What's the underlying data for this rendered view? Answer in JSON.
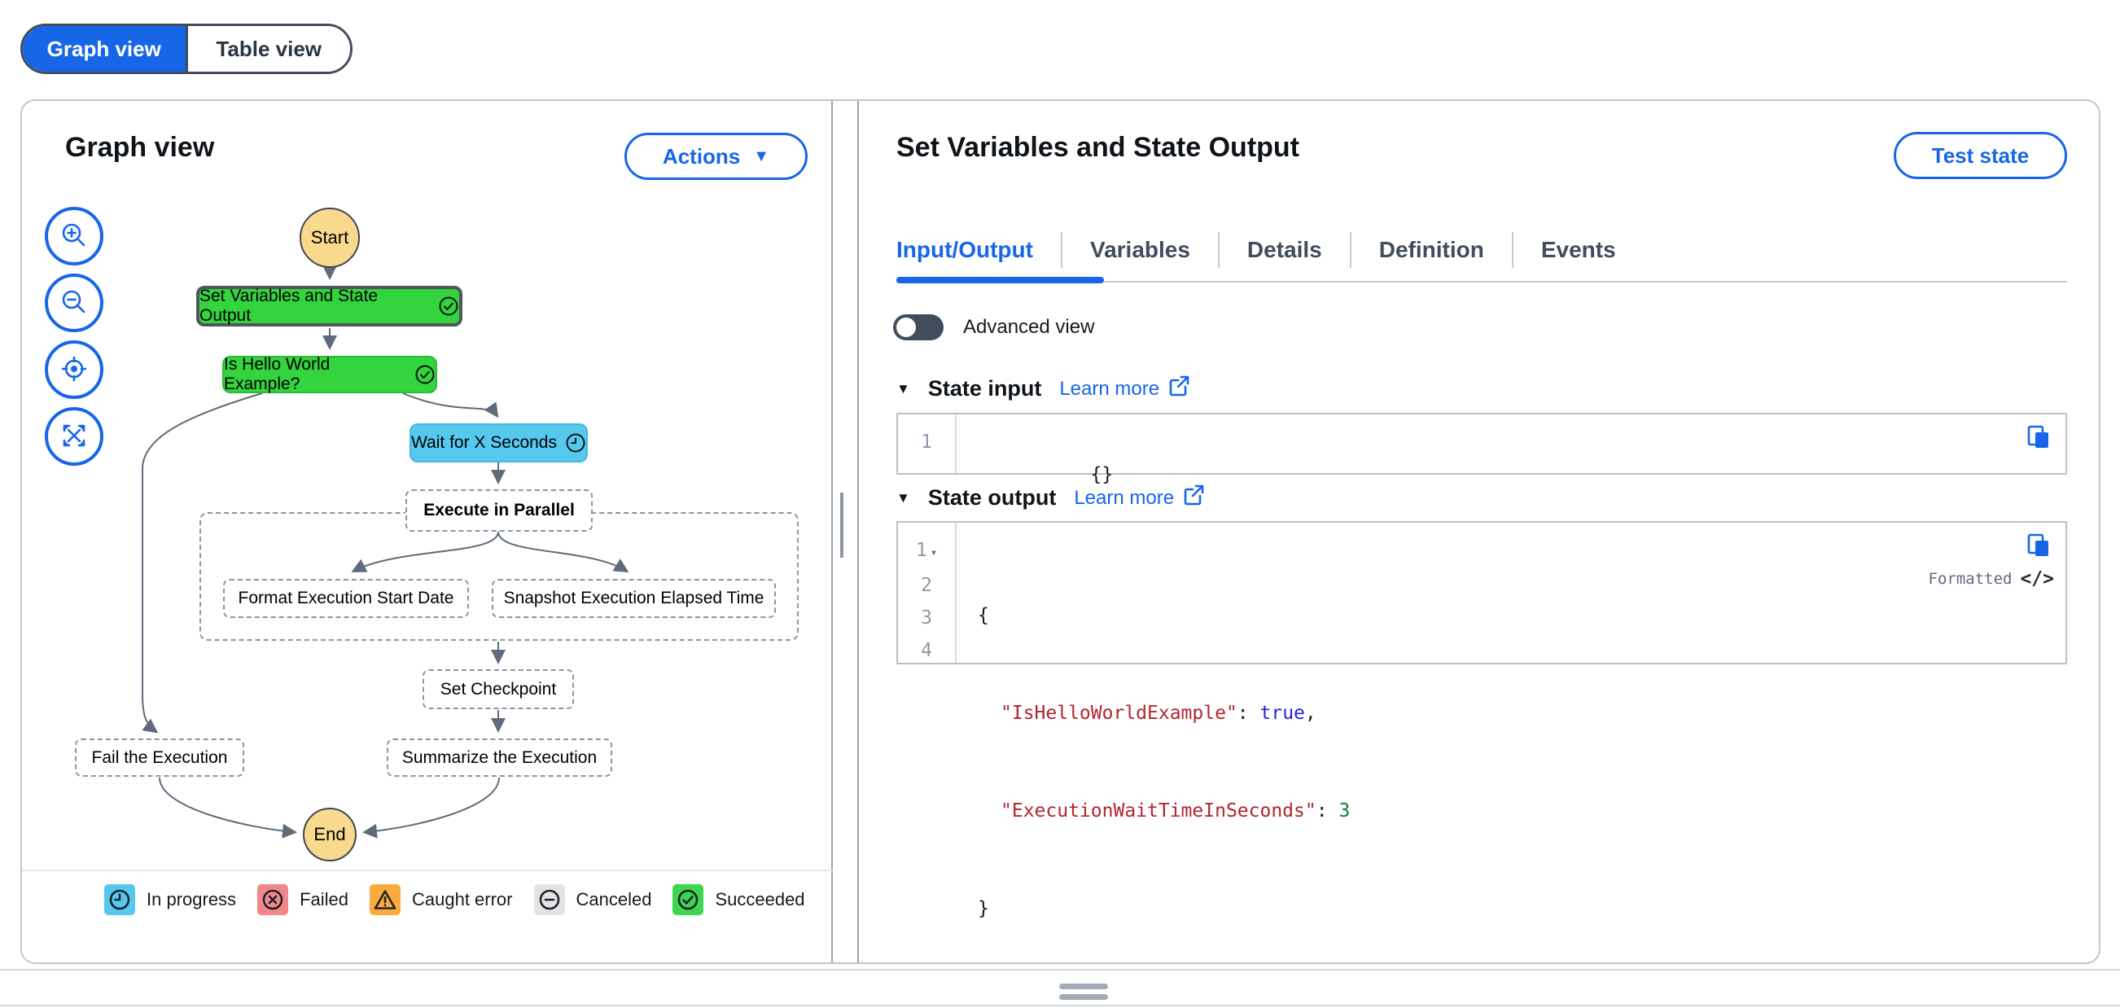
{
  "view_toggle": {
    "graph_label": "Graph view",
    "table_label": "Table view"
  },
  "graph_panel": {
    "title": "Graph view",
    "actions_label": "Actions",
    "zoom_controls": [
      "zoom-in",
      "zoom-out",
      "center-view",
      "fullscreen"
    ],
    "nodes": {
      "start": "Start",
      "set_variables": "Set Variables and State Output",
      "is_hello": "Is Hello World Example?",
      "wait": "Wait for X Seconds",
      "parallel": "Execute in Parallel",
      "format_date": "Format Execution Start Date",
      "snapshot": "Snapshot Execution Elapsed Time",
      "checkpoint": "Set Checkpoint",
      "summarize": "Summarize the Execution",
      "fail": "Fail the Execution",
      "end": "End"
    },
    "legend": [
      {
        "icon": "clock-icon",
        "label": "In progress",
        "color": "#56c8ee"
      },
      {
        "icon": "x-circle-icon",
        "label": "Failed",
        "color": "#f38688"
      },
      {
        "icon": "warning-icon",
        "label": "Caught error",
        "color": "#fbab3c"
      },
      {
        "icon": "minus-circle-icon",
        "label": "Canceled",
        "color": "#e3e3e3"
      },
      {
        "icon": "check-circle-icon",
        "label": "Succeeded",
        "color": "#3fd64f"
      }
    ]
  },
  "details_panel": {
    "title": "Set Variables and State Output",
    "test_state_label": "Test state",
    "tabs": [
      {
        "label": "Input/Output",
        "active": true
      },
      {
        "label": "Variables",
        "active": false
      },
      {
        "label": "Details",
        "active": false
      },
      {
        "label": "Definition",
        "active": false
      },
      {
        "label": "Events",
        "active": false
      }
    ],
    "advanced_view_label": "Advanced view",
    "state_input": {
      "heading": "State input",
      "learn_more_label": "Learn more",
      "line_number": "1",
      "code": "{}"
    },
    "state_output": {
      "heading": "State output",
      "learn_more_label": "Learn more",
      "formatted_label": "Formatted",
      "line_numbers": [
        "1",
        "2",
        "3",
        "4"
      ],
      "l1": "{",
      "l2_key": "\"IsHelloWorldExample\"",
      "l2_sep": ": ",
      "l2_val": "true",
      "l2_comma": ",",
      "l3_key": "\"ExecutionWaitTimeInSeconds\"",
      "l3_sep": ": ",
      "l3_val": "3",
      "l4": "}"
    }
  },
  "icons": {
    "actions_caret": "▼",
    "section_caret": "▼",
    "gutter_caret": "▾"
  },
  "colors": {
    "accent_blue": "#1766e8",
    "node_green": "#33d43e",
    "node_blue": "#56c8ee",
    "terminal_yellow": "#f9d98d",
    "selected_border": "#50555e",
    "code_key": "#b0262d",
    "code_bool": "#2525d2",
    "code_number": "#15803d"
  }
}
